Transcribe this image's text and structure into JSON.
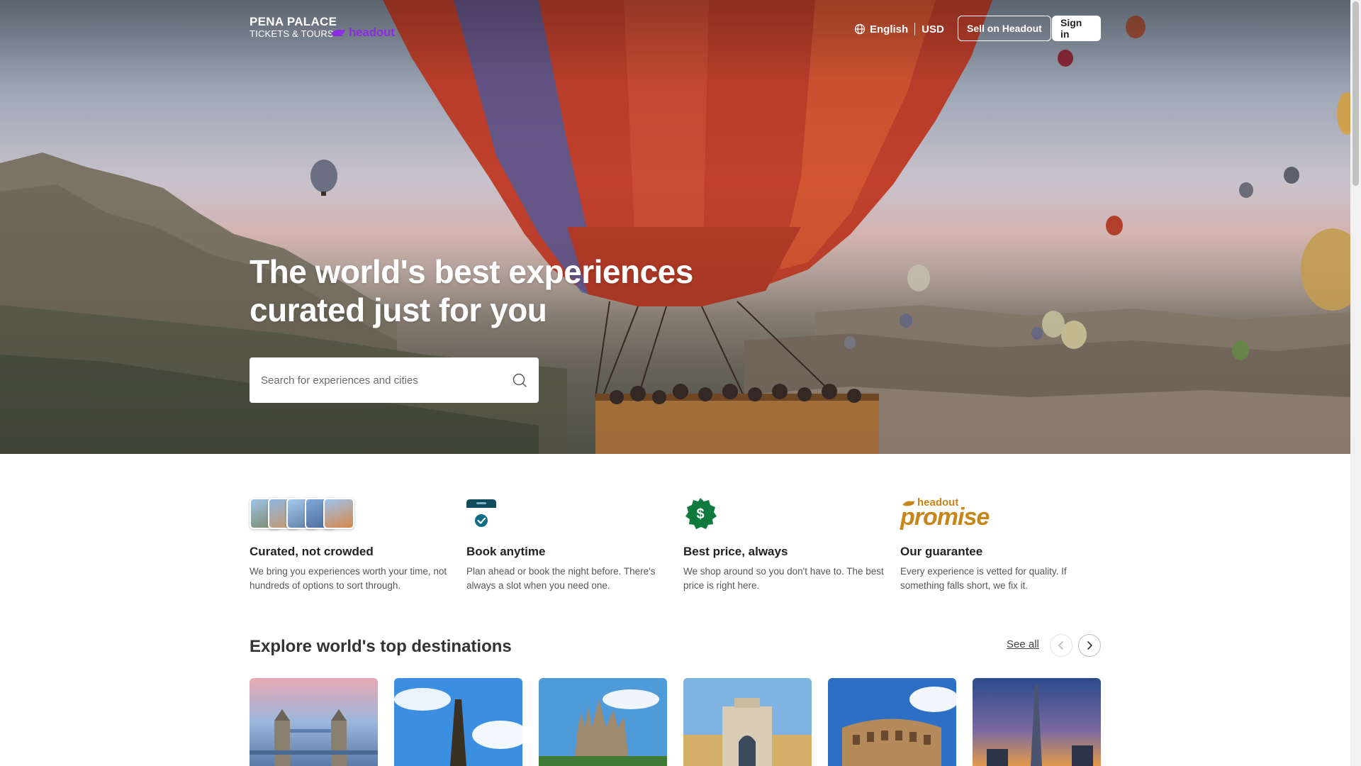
{
  "header": {
    "logo_line1": "PENA PALACE",
    "logo_line2": "TICKETS & TOURS",
    "partner_logo": "headout",
    "language": "English",
    "currency": "USD",
    "sell_label": "Sell on Headout",
    "signin_label": "Sign in"
  },
  "hero": {
    "title": "The world's best experiences curated just for you",
    "search_placeholder": "Search for experiences and cities"
  },
  "features": [
    {
      "icon": "destination-cards-icon",
      "title": "Curated, not crowded",
      "text": "We bring you experiences worth your time, not hundreds of options to sort through."
    },
    {
      "icon": "calendar-check-icon",
      "title": "Book anytime",
      "text": "Plan ahead or book the night before. There's always a slot when you need one."
    },
    {
      "icon": "price-badge-icon",
      "title": "Best price, always",
      "text": "We shop around so you don't have to. The best price is right here."
    },
    {
      "icon": "headout-promise-logo",
      "title": "Our guarantee",
      "text": "Every experience is vetted for quality. If something falls short, we fix it.",
      "logo_top": "headout",
      "logo_bottom": "promise"
    }
  ],
  "destinations": {
    "title": "Explore world's top destinations",
    "see_all_label": "See all",
    "cards": [
      {
        "icon": "tower-bridge-image"
      },
      {
        "icon": "eiffel-tower-image"
      },
      {
        "icon": "sagrada-familia-image"
      },
      {
        "icon": "rua-augusta-arch-image"
      },
      {
        "icon": "colosseum-image"
      },
      {
        "icon": "burj-khalifa-image"
      }
    ]
  },
  "colors": {
    "brand_purple": "#8a2ce2",
    "promise_gold": "#c8861a",
    "badge_green": "#0f7a3d",
    "calendar_teal": "#0f4d5c"
  }
}
